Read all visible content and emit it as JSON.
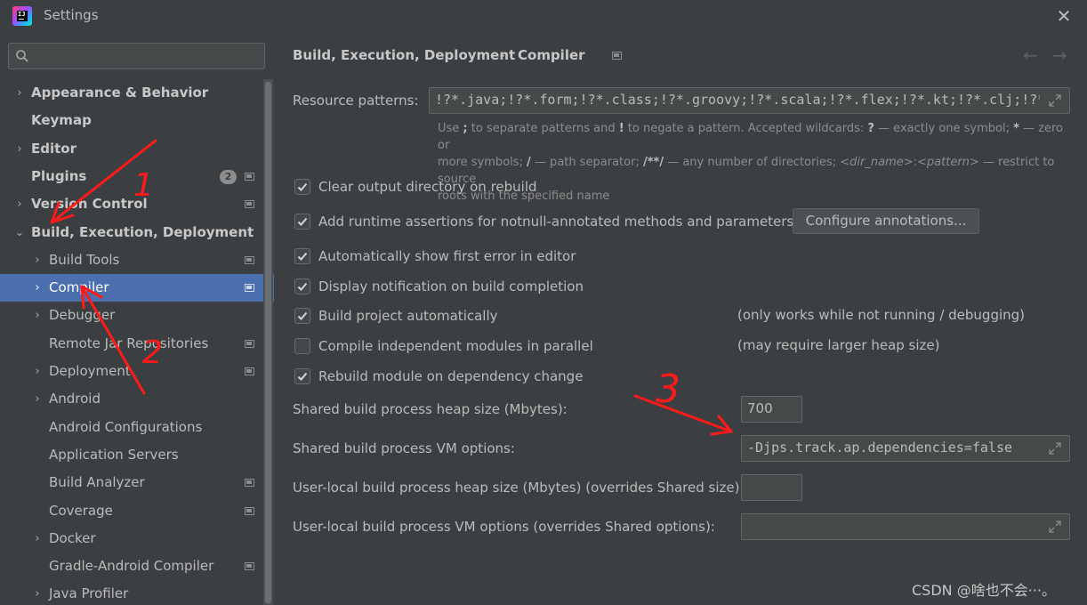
{
  "window": {
    "title": "Settings"
  },
  "sidebar": {
    "search_placeholder": "",
    "items": [
      {
        "label": "Appearance & Behavior",
        "chevron": "›",
        "bold": true
      },
      {
        "label": "Keymap",
        "bold": true
      },
      {
        "label": "Editor",
        "chevron": "›",
        "bold": true
      },
      {
        "label": "Plugins",
        "bold": true,
        "badge": "2"
      },
      {
        "label": "Version Control",
        "chevron": "›",
        "bold": true
      },
      {
        "label": "Build, Execution, Deployment",
        "chevron": "⌄",
        "bold": true
      },
      {
        "label": "Build Tools",
        "chevron": "›"
      },
      {
        "label": "Compiler",
        "chevron": "›",
        "selected": true
      },
      {
        "label": "Debugger",
        "chevron": "›"
      },
      {
        "label": "Remote Jar Repositories"
      },
      {
        "label": "Deployment",
        "chevron": "›"
      },
      {
        "label": "Android",
        "chevron": "›"
      },
      {
        "label": "Android Configurations"
      },
      {
        "label": "Application Servers"
      },
      {
        "label": "Build Analyzer"
      },
      {
        "label": "Coverage"
      },
      {
        "label": "Docker",
        "chevron": "›"
      },
      {
        "label": "Gradle-Android Compiler"
      },
      {
        "label": "Java Profiler",
        "chevron": "›"
      }
    ]
  },
  "breadcrumb": {
    "parent": "Build, Execution, Deployment",
    "separator": "›",
    "current": "Compiler"
  },
  "nav": {
    "back": "←",
    "forward": "→"
  },
  "compiler": {
    "resource_patterns_label": "Resource patterns:",
    "resource_patterns_value": "!?*.java;!?*.form;!?*.class;!?*.groovy;!?*.scala;!?*.flex;!?*.kt;!?*.clj;!?*.aj",
    "help_text": {
      "line1_a": "Use ",
      "line1_b": ";",
      "line1_c": " to separate patterns and ",
      "line1_d": "!",
      "line1_e": " to negate a pattern. Accepted wildcards: ",
      "line1_f": "?",
      "line1_g": " — exactly one symbol; ",
      "line1_h": "*",
      "line1_i": " — zero or",
      "line2_a": "more symbols; ",
      "line2_b": "/",
      "line2_c": " — path separator; ",
      "line2_d": "/**/",
      "line2_e": " — any number of directories; ",
      "line2_f": "<dir_name>",
      "line2_g": ":",
      "line2_h": "<pattern>",
      "line2_i": " — restrict to source",
      "line3": "roots with the specified name"
    },
    "checkboxes": [
      {
        "label": "Clear output directory on rebuild",
        "checked": true
      },
      {
        "label": "Add runtime assertions for notnull-annotated methods and parameters",
        "checked": true
      },
      {
        "label": "Automatically show first error in editor",
        "checked": true
      },
      {
        "label": "Display notification on build completion",
        "checked": true
      },
      {
        "label": "Build project automatically",
        "checked": true,
        "note": "(only works while not running / debugging)"
      },
      {
        "label": "Compile independent modules in parallel",
        "checked": false,
        "note": "(may require larger heap size)"
      },
      {
        "label": "Rebuild module on dependency change",
        "checked": true
      }
    ],
    "configure_button": "Configure annotations...",
    "shared_heap_label": "Shared build process heap size (Mbytes):",
    "shared_heap_value": "700",
    "shared_vm_label": "Shared build process VM options:",
    "shared_vm_value": "-Djps.track.ap.dependencies=false",
    "user_heap_label": "User-local build process heap size (Mbytes) (overrides Shared size):",
    "user_heap_value": "",
    "user_vm_label": "User-local build process VM options (overrides Shared options):",
    "user_vm_value": ""
  },
  "annotations": {
    "mark1": "1",
    "mark2": "2",
    "mark3": "3",
    "color": "#ff1a1a"
  },
  "watermark": "CSDN @啥也不会···。"
}
